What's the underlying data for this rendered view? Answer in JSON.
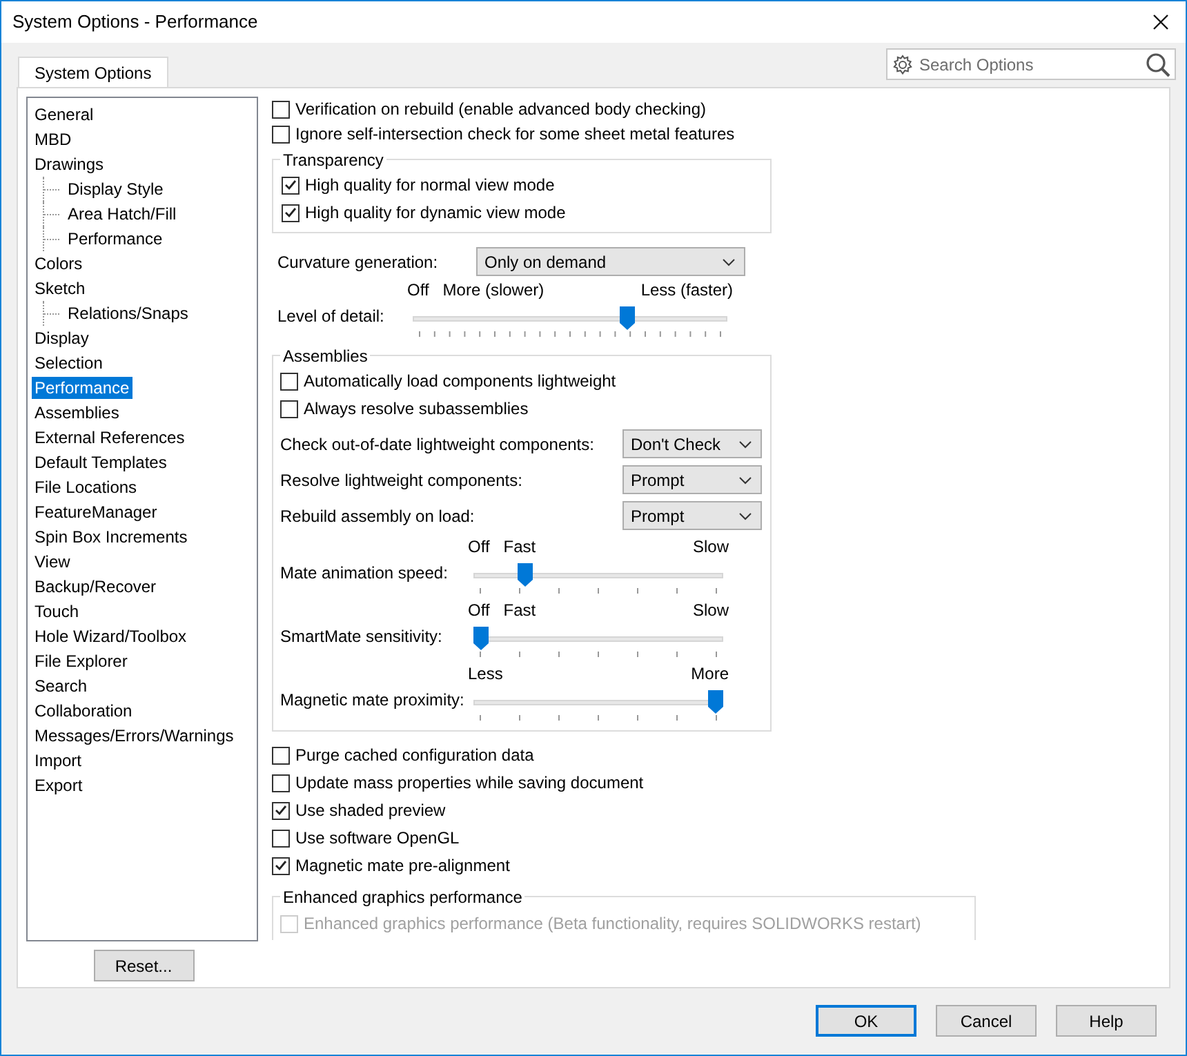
{
  "window": {
    "title": "System Options - Performance"
  },
  "tabs": [
    {
      "label": "System Options",
      "selected": true
    }
  ],
  "search": {
    "placeholder": "Search Options"
  },
  "tree": [
    {
      "label": "General",
      "selected": false
    },
    {
      "label": "MBD",
      "selected": false
    },
    {
      "label": "Drawings",
      "selected": false,
      "children": [
        {
          "label": "Display Style",
          "selected": false
        },
        {
          "label": "Area Hatch/Fill",
          "selected": false
        },
        {
          "label": "Performance",
          "selected": false
        }
      ]
    },
    {
      "label": "Colors",
      "selected": false
    },
    {
      "label": "Sketch",
      "selected": false,
      "children": [
        {
          "label": "Relations/Snaps",
          "selected": false
        }
      ]
    },
    {
      "label": "Display",
      "selected": false
    },
    {
      "label": "Selection",
      "selected": false
    },
    {
      "label": "Performance",
      "selected": true
    },
    {
      "label": "Assemblies",
      "selected": false
    },
    {
      "label": "External References",
      "selected": false
    },
    {
      "label": "Default Templates",
      "selected": false
    },
    {
      "label": "File Locations",
      "selected": false
    },
    {
      "label": "FeatureManager",
      "selected": false
    },
    {
      "label": "Spin Box Increments",
      "selected": false
    },
    {
      "label": "View",
      "selected": false
    },
    {
      "label": "Backup/Recover",
      "selected": false
    },
    {
      "label": "Touch",
      "selected": false
    },
    {
      "label": "Hole Wizard/Toolbox",
      "selected": false
    },
    {
      "label": "File Explorer",
      "selected": false
    },
    {
      "label": "Search",
      "selected": false
    },
    {
      "label": "Collaboration",
      "selected": false
    },
    {
      "label": "Messages/Errors/Warnings",
      "selected": false
    },
    {
      "label": "Import",
      "selected": false
    },
    {
      "label": "Export",
      "selected": false
    }
  ],
  "reset_button": "Reset...",
  "top_options": [
    {
      "label": "Verification on rebuild (enable advanced body checking)",
      "checked": false
    },
    {
      "label": "Ignore self-intersection check for some sheet metal features",
      "checked": false
    }
  ],
  "transparency": {
    "title": "Transparency",
    "items": [
      {
        "label": "High quality for normal view mode",
        "checked": true
      },
      {
        "label": "High quality for dynamic view mode",
        "checked": true
      }
    ]
  },
  "curvature": {
    "label": "Curvature generation:",
    "value": "Only on demand"
  },
  "level_of_detail": {
    "label": "Level of detail:",
    "marks": [
      "Off",
      "More (slower)",
      "Less (faster)"
    ],
    "level": 0.69
  },
  "assemblies": {
    "title": "Assemblies",
    "checkboxes": [
      {
        "label": "Automatically load components lightweight",
        "checked": false
      },
      {
        "label": "Always resolve subassemblies",
        "checked": false
      }
    ],
    "dropdowns": [
      {
        "label": "Check out-of-date lightweight components:",
        "value": "Don't Check"
      },
      {
        "label": "Resolve lightweight components:",
        "value": "Prompt"
      },
      {
        "label": "Rebuild assembly on load:",
        "value": "Prompt"
      }
    ],
    "sliders": [
      {
        "label": "Mate animation speed:",
        "marks": [
          "Off",
          "Fast",
          "Slow"
        ],
        "level": 0.19
      },
      {
        "label": "SmartMate sensitivity:",
        "marks": [
          "Off",
          "Fast",
          "Slow"
        ],
        "level": 0
      },
      {
        "label": "Magnetic mate proximity:",
        "marks": [
          "Less",
          "More"
        ],
        "level": 1
      }
    ]
  },
  "bottom_options": [
    {
      "label": "Purge cached configuration data",
      "checked": false
    },
    {
      "label": "Update mass properties while saving document",
      "checked": false
    },
    {
      "label": "Use shaded preview",
      "checked": true
    },
    {
      "label": "Use software OpenGL",
      "checked": false
    },
    {
      "label": "Magnetic mate pre-alignment",
      "checked": true
    }
  ],
  "enhanced": {
    "title": "Enhanced graphics performance",
    "items": [
      {
        "label": "Enhanced graphics performance (Beta functionality, requires SOLIDWORKS restart)",
        "checked": false,
        "disabled": true
      }
    ]
  },
  "buttons": [
    {
      "label": "OK",
      "default": true
    },
    {
      "label": "Cancel",
      "default": false
    },
    {
      "label": "Help",
      "default": false
    }
  ]
}
